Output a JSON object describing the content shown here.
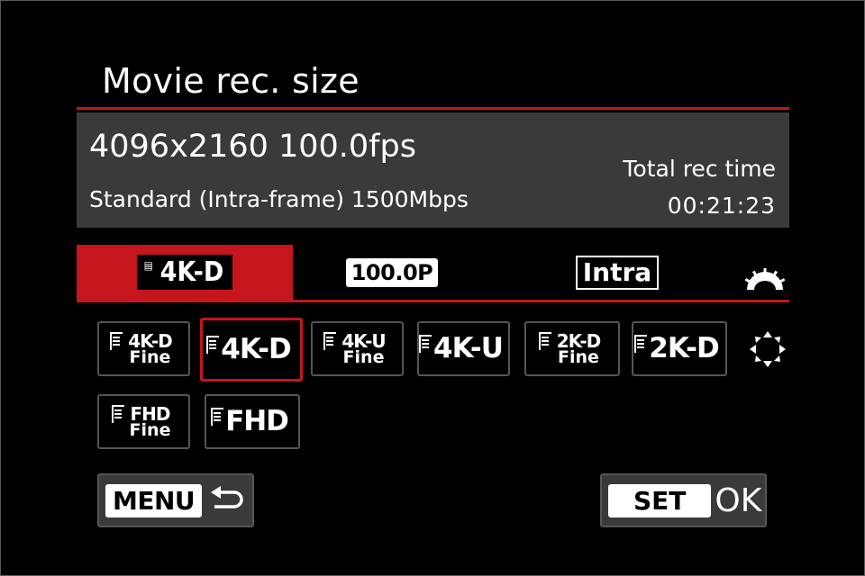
{
  "screen": {
    "title": "Movie rec. size",
    "accent_color": "#c4161c"
  },
  "info": {
    "resolution_fps": "4096x2160 100.0fps",
    "codec": "Standard (Intra-frame) 1500Mbps",
    "total_rec_label": "Total rec time",
    "total_rec_time": "00:21:23"
  },
  "tabs": [
    {
      "label": "4K-D",
      "selected": true
    },
    {
      "label": "100.0P",
      "selected": false
    },
    {
      "label": "Intra",
      "selected": false
    }
  ],
  "tab_dial_icon": "main-dial-icon",
  "options": [
    {
      "top": "4K-D",
      "fine": "Fine",
      "selected": false
    },
    {
      "main": "4K-D",
      "selected": true
    },
    {
      "top": "4K-U",
      "fine": "Fine",
      "selected": false
    },
    {
      "main": "4K-U",
      "selected": false
    },
    {
      "top": "2K-D",
      "fine": "Fine",
      "selected": false
    },
    {
      "main": "2K-D",
      "selected": false
    },
    {
      "top": "FHD",
      "fine": "Fine",
      "selected": false
    },
    {
      "main": "FHD",
      "selected": false
    }
  ],
  "nav_icon": "multi-controller-icon",
  "buttons": {
    "menu_label": "MENU",
    "set_label": "SET",
    "ok_label": "OK"
  }
}
